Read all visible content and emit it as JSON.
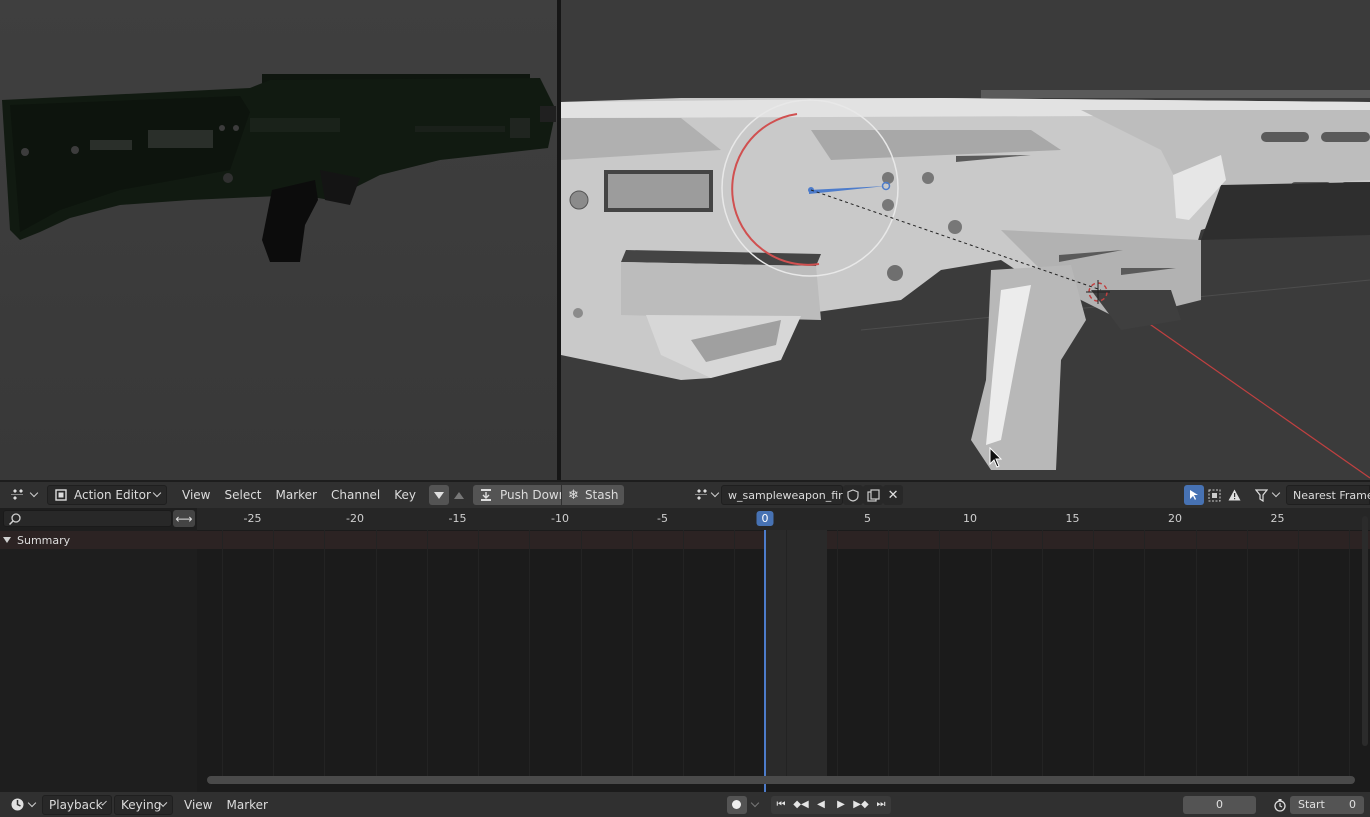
{
  "viewports": {
    "left": {
      "description_icon": "viewport-shaded-view"
    },
    "right": {
      "description_icon": "viewport-solid-view"
    }
  },
  "dopesheet_header": {
    "editor_type_icon": "dopesheet-icon",
    "mode": "Action Editor",
    "menus": [
      "View",
      "Select",
      "Marker",
      "Channel",
      "Key"
    ],
    "push_down": "Push Down",
    "stash": "Stash",
    "action_name": "w_sampleweapon_fire",
    "snapping": "Nearest Frame"
  },
  "channels": {
    "search_placeholder": "",
    "summary": "Summary"
  },
  "timeline": {
    "ticks": [
      "-25",
      "-20",
      "-15",
      "-10",
      "-5",
      "0",
      "5",
      "10",
      "15",
      "20",
      "25"
    ],
    "current_frame": "0"
  },
  "footer": {
    "menus": [
      "Playback",
      "Keying",
      "View",
      "Marker"
    ],
    "frame_value": "0",
    "start_label": "Start",
    "start_value": "0"
  },
  "colors": {
    "accent": "#4772b3",
    "summary_bg": "#2c2323",
    "playhead": "#4d7ccb"
  }
}
